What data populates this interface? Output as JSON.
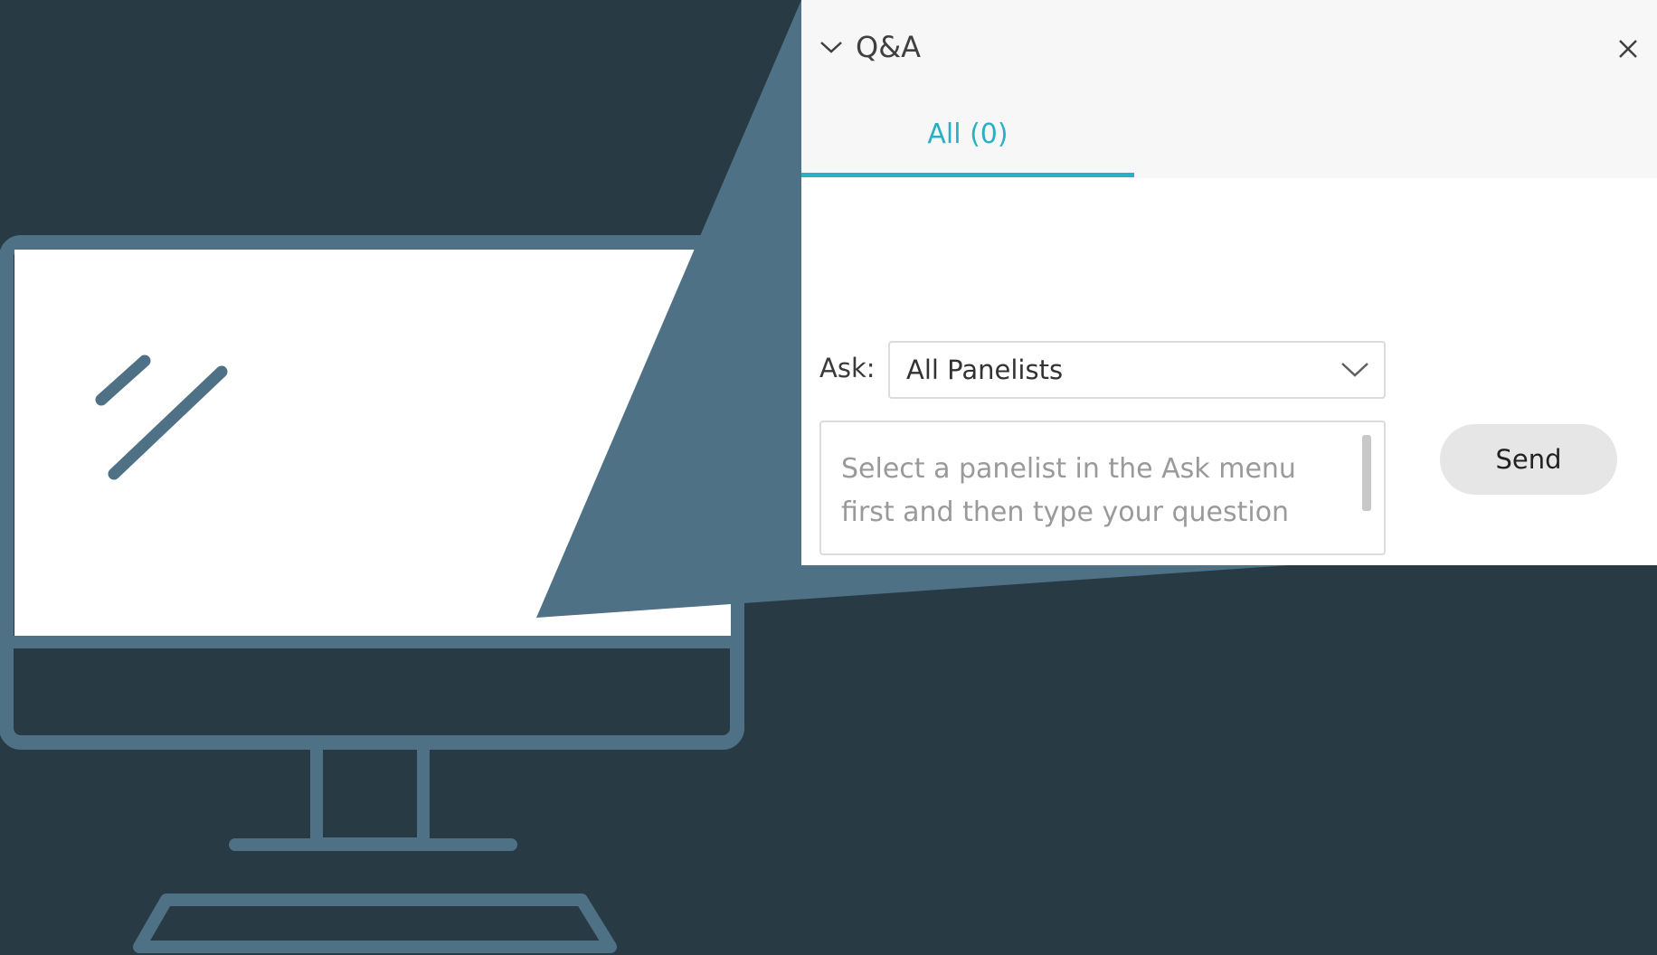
{
  "colors": {
    "background": "#283a44",
    "illustration": "#4f7186",
    "accent": "#2ab0c6",
    "panel": "#ffffff"
  },
  "icons": {
    "collapse": "chevron-down-icon",
    "close": "close-icon",
    "dropdown": "chevron-down-icon"
  },
  "qa_panel": {
    "title": "Q&A",
    "tabs": [
      {
        "label": "All (0)",
        "selected": true
      }
    ],
    "ask_label": "Ask:",
    "ask_selected": "All Panelists",
    "question_placeholder": "Select a panelist in the Ask menu first and then type your question",
    "send_label": "Send"
  }
}
